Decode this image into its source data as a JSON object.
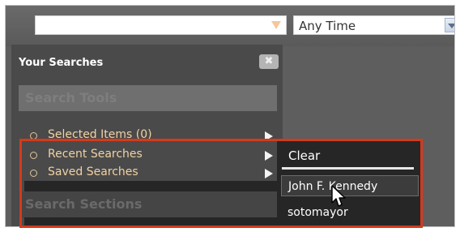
{
  "search": {
    "query_value": "",
    "time_select": "Any Time"
  },
  "panel": {
    "title": "Your Searches",
    "close_label": "✖",
    "tools_header": "Search Tools",
    "sections_header": "Search Sections",
    "items": [
      {
        "label": "Selected Items (0)"
      },
      {
        "label": "Recent Searches"
      },
      {
        "label": "Saved Searches"
      }
    ]
  },
  "submenu": {
    "clear_label": "Clear",
    "items": [
      {
        "label": "John F. Kennedy"
      },
      {
        "label": "sotomayor"
      }
    ]
  },
  "colors": {
    "accent": "#d43a1b",
    "menu_text": "#f0d2a4",
    "panel_bg": "#4a4a4a"
  },
  "icons": {
    "search_dropdown": "triangle-down-icon",
    "time_dropdown": "chevron-down-icon",
    "close": "close-icon",
    "submenu_arrow": "triangle-right-icon",
    "cursor": "hand-pointer-icon"
  }
}
